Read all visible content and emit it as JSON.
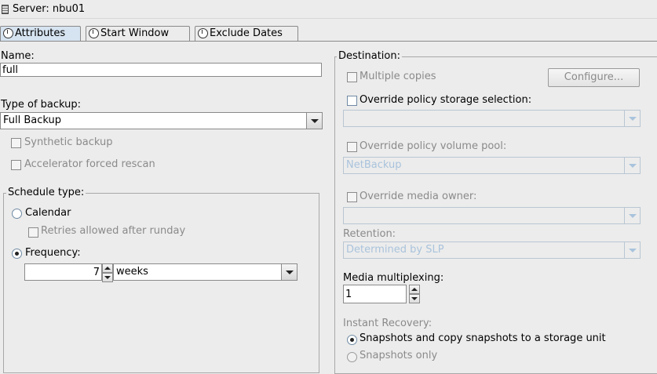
{
  "window": {
    "title": "Server: nbu01"
  },
  "tabs": [
    {
      "label": "Attributes",
      "icon": "clock-icon",
      "active": true
    },
    {
      "label": "Start Window",
      "icon": "clock-icon",
      "active": false
    },
    {
      "label": "Exclude Dates",
      "icon": "clock-icon",
      "active": false
    }
  ],
  "attributes": {
    "name_label": "Name:",
    "name_value": "full",
    "type_label": "Type of backup:",
    "type_value": "Full Backup",
    "synthetic_label": "Synthetic backup",
    "accelerator_label": "Accelerator forced rescan",
    "schedule_type": {
      "title": "Schedule type:",
      "calendar_label": "Calendar",
      "retries_label": "Retries allowed after runday",
      "frequency_label": "Frequency:",
      "frequency_value": "7",
      "frequency_unit": "weeks",
      "selected": "Frequency"
    }
  },
  "destination": {
    "title": "Destination:",
    "multiple_copies_label": "Multiple copies",
    "configure_label": "Configure...",
    "override_storage_label": "Override policy storage selection:",
    "storage_value": "",
    "override_volume_label": "Override policy volume pool:",
    "volume_pool_value": "NetBackup",
    "override_owner_label": "Override media owner:",
    "owner_value": "",
    "retention_label": "Retention:",
    "retention_value": "Determined by SLP",
    "multiplexing_label": "Media multiplexing:",
    "multiplexing_value": "1"
  },
  "instant_recovery": {
    "label": "Instant Recovery:",
    "option1": "Snapshots and copy snapshots to a storage unit",
    "option2": "Snapshots only",
    "selected": "Snapshots and copy snapshots to a storage unit"
  },
  "colors": {
    "background": "#ececec",
    "active_tab": "#d6e3f0",
    "disabled_text": "#8a8a8a",
    "disabled_combo_text": "#a9c3dc"
  }
}
